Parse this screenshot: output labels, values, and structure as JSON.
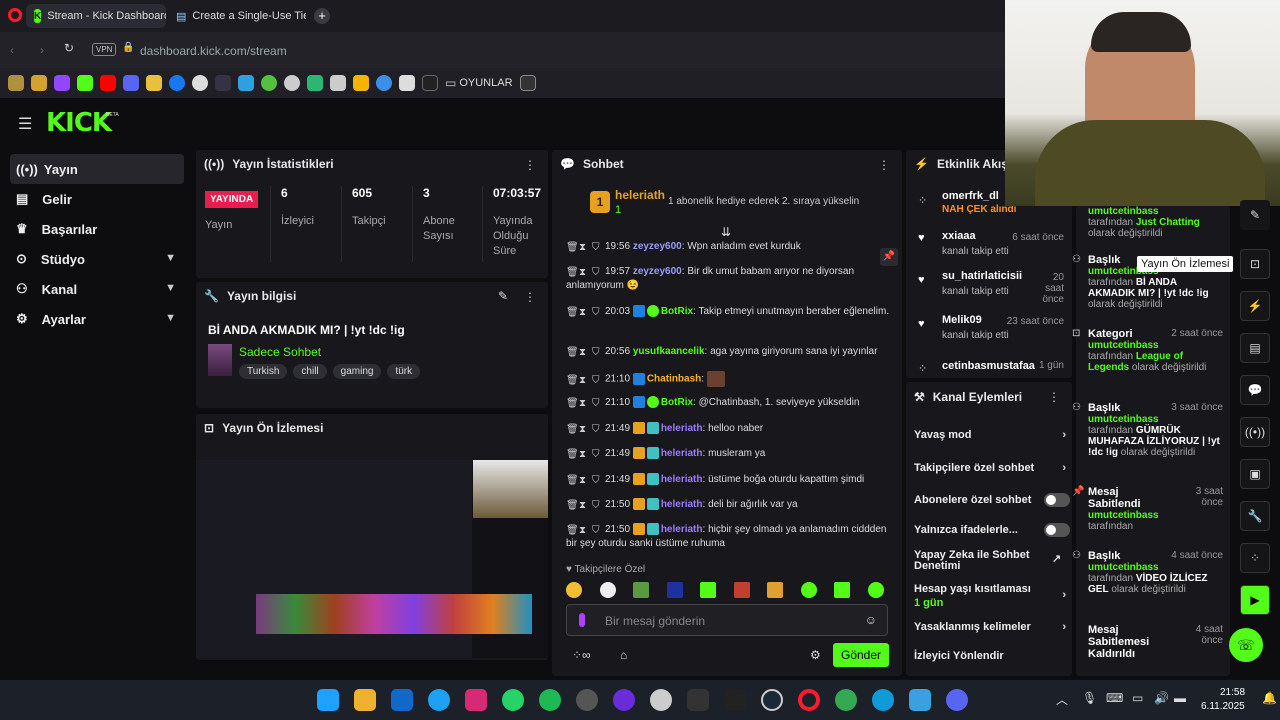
{
  "browser": {
    "tabs": [
      {
        "label": "Stream - Kick Dashboard"
      },
      {
        "label": "Create a Single-Use Tier L"
      }
    ],
    "url": "dashboard.kick.com/stream",
    "vpn": "VPN",
    "bookmark_folder": "OYUNLAR"
  },
  "kick": {
    "logo": "KICK",
    "beta": "BETA"
  },
  "sidebar": {
    "items": [
      {
        "label": "Yayın"
      },
      {
        "label": "Gelir"
      },
      {
        "label": "Başarılar"
      },
      {
        "label": "Stüdyo"
      },
      {
        "label": "Kanal"
      },
      {
        "label": "Ayarlar"
      }
    ]
  },
  "stats": {
    "title": "Yayın İstatistikleri",
    "live": "YAYINDA",
    "live_label": "Yayın",
    "cells": [
      {
        "value": "6",
        "label": "İzleyici"
      },
      {
        "value": "605",
        "label": "Takipçi"
      },
      {
        "value": "3",
        "label": "Abone Sayısı"
      },
      {
        "value": "07:03:57",
        "label": "Yayında Olduğu Süre"
      }
    ]
  },
  "info": {
    "title": "Yayın bilgisi",
    "stream_title": "Bİ ANDA AKMADIK MI? | !yt !dc !ig",
    "category": "Sadece Sohbet",
    "tags": [
      "Turkish",
      "chill",
      "gaming",
      "türk"
    ]
  },
  "preview": {
    "title": "Yayın Ön İzlemesi"
  },
  "chat": {
    "title": "Sohbet",
    "top_user": "heleriath",
    "top_count": "1",
    "top_rank": "1",
    "top_msg": "1 abonelik hediye ederek 2. sıraya yükselin",
    "messages": [
      {
        "time": "19:56",
        "user": "zeyzey600",
        "text": "Wpn anladım evet kurduk"
      },
      {
        "time": "19:57",
        "user": "zeyzey600",
        "text": "Bir dk umut babam arıyor ne diyorsan anlamıyorum 😉"
      },
      {
        "time": "20:03",
        "user": "BotRix",
        "text": "Takip etmeyi unutmayın beraber eğlenelim."
      },
      {
        "time": "20:56",
        "user": "yusufkaancelik",
        "text": "aga yayına giriyorum sana iyi yayınlar"
      },
      {
        "time": "21:10",
        "user": "Chatinbash",
        "text": ""
      },
      {
        "time": "21:10",
        "user": "BotRix",
        "text": "@Chatinbash, 1. seviyeye yükseldin"
      },
      {
        "time": "21:49",
        "user": "heleriath",
        "text": "helloo naber"
      },
      {
        "time": "21:49",
        "user": "heleriath",
        "text": "musleram ya"
      },
      {
        "time": "21:49",
        "user": "heleriath",
        "text": "üstüme boğa oturdu kapattım şimdi"
      },
      {
        "time": "21:50",
        "user": "heleriath",
        "text": "deli bir ağırlık var ya"
      },
      {
        "time": "21:50",
        "user": "heleriath",
        "text": "hiçbir şey olmadı ya anlamadım ciddden bir şey oturdu sanki üstüme ruhuma"
      }
    ],
    "mode": "Takipçilere Özel",
    "placeholder": "Bir mesaj gönderin",
    "send": "Gönder"
  },
  "activity": {
    "title": "Etkinlik Akışı",
    "items": [
      {
        "name": "omerfrk_dl",
        "sub": "NAH ÇEK alındı",
        "time": ""
      },
      {
        "name": "xxiaaa",
        "sub": "kanalı takip etti",
        "time": "6 saat önce"
      },
      {
        "name": "su_hatirlaticisii",
        "sub": "kanalı takip etti",
        "time": "20 saat önce"
      },
      {
        "name": "Melik09",
        "sub": "kanalı takip etti",
        "time": "23 saat önce"
      },
      {
        "name": "cetinbasmustafaa",
        "sub": "",
        "time": "1 gün"
      }
    ]
  },
  "actions": {
    "title": "Kanal Eylemleri",
    "items": [
      {
        "label": "Yavaş mod"
      },
      {
        "label": "Takipçilere özel sohbet"
      },
      {
        "label": "Abonelere özel sohbet"
      },
      {
        "label": "Yalnızca ifadelerle..."
      },
      {
        "label": "Yapay Zeka ile Sohbet Denetimi"
      },
      {
        "label": "Hesap yaşı kısıtlaması",
        "sub": "1 gün"
      },
      {
        "label": "Yasaklanmış kelimeler"
      },
      {
        "label": "İzleyici Yönlendir"
      }
    ]
  },
  "log": {
    "items": [
      {
        "title": "",
        "user": "umutcetinbass",
        "pre": "tarafından",
        "val": "Just Chatting",
        "post": "olarak değiştirildi",
        "time": ""
      },
      {
        "title": "Başlık",
        "user": "umutcetinbass",
        "pre": "tarafından",
        "val": "Bİ ANDA AKMADIK MI? | !yt !dc !ig",
        "post": "olarak değiştirildi",
        "time": ""
      },
      {
        "title": "Kategori",
        "user": "umutcetinbass",
        "pre": "tarafından",
        "val": "League of Legends",
        "post": "olarak değiştirildi",
        "time": "2 saat önce"
      },
      {
        "title": "Başlık",
        "user": "umutcetinbass",
        "pre": "tarafından",
        "val": "GÜMRÜK MUHAFAZA İZLİYORUZ | !yt !dc !ig",
        "post": "olarak değiştirildi",
        "time": "3 saat önce"
      },
      {
        "title": "Mesaj Sabitlendi",
        "user": "umutcetinbass",
        "pre": "tarafından",
        "val": "",
        "post": "",
        "time": "3 saat önce"
      },
      {
        "title": "Başlık",
        "user": "umutcetinbass",
        "pre": "tarafından",
        "val": "VİDEO İZLİCEZ GEL",
        "post": "olarak değiştirildi",
        "time": "4 saat önce"
      },
      {
        "title": "Mesaj Sabitlemesi Kaldırıldı",
        "user": "",
        "pre": "",
        "val": "",
        "post": "",
        "time": "4 saat önce"
      }
    ],
    "tooltip": "Yayın Ön İzlemesi"
  },
  "taskbar": {
    "time": "21:58",
    "date": "6.11.2025"
  },
  "colors": {
    "accent": "#53fc18",
    "live": "#e91e4f",
    "bg": "#0d0d0f",
    "panel": "#18181c"
  }
}
